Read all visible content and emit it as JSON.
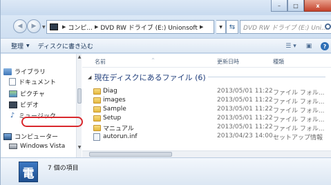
{
  "window": {
    "minimize_glyph": "–",
    "maximize_glyph": "□",
    "close_glyph": "x"
  },
  "address_bar": {
    "segments": [
      "コンピ...",
      "DVD RW ドライブ (E:) Unionsoft"
    ],
    "search_placeholder": "DVD RW ドライブ (E:) Uni..."
  },
  "toolbar": {
    "organize_label": "整理",
    "burn_label": "ディスクに書き込む"
  },
  "nav_pane": {
    "items": [
      {
        "label": "ライブラリ",
        "icon": "library-icon"
      },
      {
        "label": "ドキュメント",
        "icon": "document-icon"
      },
      {
        "label": "ピクチャ",
        "icon": "picture-icon"
      },
      {
        "label": "ビデオ",
        "icon": "video-icon"
      },
      {
        "label": "ミュージック",
        "icon": "music-icon"
      },
      {
        "label": "コンピューター",
        "icon": "computer-icon"
      },
      {
        "label": "Windows Vista",
        "icon": "drive-icon"
      }
    ]
  },
  "file_list": {
    "columns": [
      "名前",
      "更新日時",
      "種類"
    ],
    "group_title": "現在ディスクにあるファイル (6)",
    "rows": [
      {
        "name": "Diag",
        "date": "2013/05/01 11:22",
        "type": "ファイル フォル...",
        "kind": "folder"
      },
      {
        "name": "images",
        "date": "2013/05/01 11:22",
        "type": "ファイル フォル...",
        "kind": "folder"
      },
      {
        "name": "Sample",
        "date": "2013/05/01 11:22",
        "type": "ファイル フォル...",
        "kind": "folder"
      },
      {
        "name": "Setup",
        "date": "2013/05/01 11:22",
        "type": "ファイル フォル...",
        "kind": "folder"
      },
      {
        "name": "マニュアル",
        "date": "2013/05/01 11:22",
        "type": "ファイル フォル...",
        "kind": "folder"
      },
      {
        "name": "autorun.inf",
        "date": "2013/04/23 14:00",
        "type": "セットアップ情報",
        "kind": "file"
      }
    ],
    "highlighted_item": "Setup"
  },
  "status_bar": {
    "icon_glyph": "電",
    "item_count_text": "7 個の項目"
  },
  "colors": {
    "highlight_ring": "#d9282d",
    "group_title": "#1e3c7a"
  }
}
